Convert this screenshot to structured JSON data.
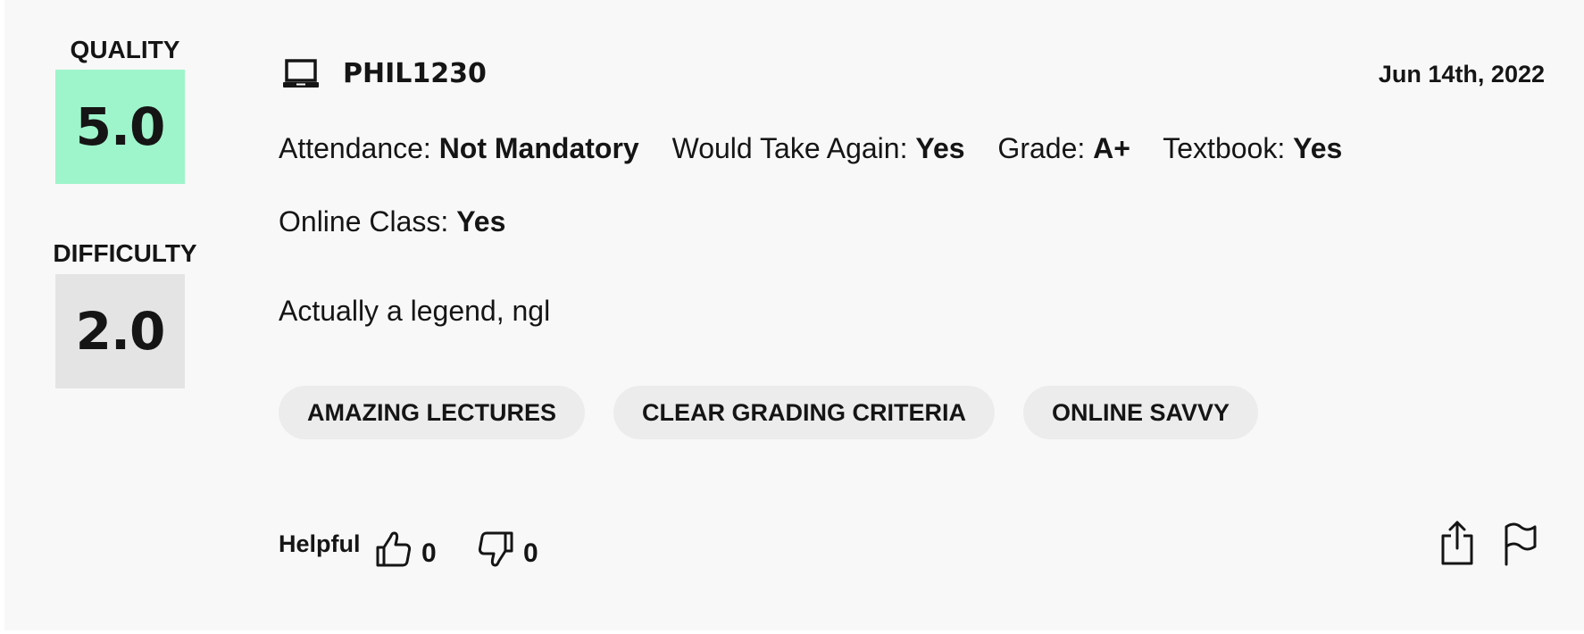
{
  "ratings": {
    "quality_label": "QUALITY",
    "quality_value": "5.0",
    "quality_color": "#9ef5cb",
    "difficulty_label": "DIFFICULTY",
    "difficulty_value": "2.0",
    "difficulty_color": "#e4e4e4"
  },
  "header": {
    "class_icon": "laptop-icon",
    "class_name": "PHIL1230",
    "date": "Jun 14th, 2022"
  },
  "meta": [
    {
      "label": "Attendance: ",
      "value": "Not Mandatory"
    },
    {
      "label": "Would Take Again: ",
      "value": "Yes"
    },
    {
      "label": "Grade: ",
      "value": "A+"
    },
    {
      "label": "Textbook: ",
      "value": "Yes"
    },
    {
      "label": "Online Class: ",
      "value": "Yes"
    }
  ],
  "comment": "Actually a legend, ngl",
  "tags": [
    "AMAZING LECTURES",
    "CLEAR GRADING CRITERIA",
    "ONLINE SAVVY"
  ],
  "footer": {
    "helpful_label": "Helpful",
    "thumbs_up_icon": "thumbs-up-icon",
    "thumbs_up_count": "0",
    "thumbs_down_icon": "thumbs-down-icon",
    "thumbs_down_count": "0",
    "share_icon": "share-icon",
    "flag_icon": "flag-icon"
  }
}
